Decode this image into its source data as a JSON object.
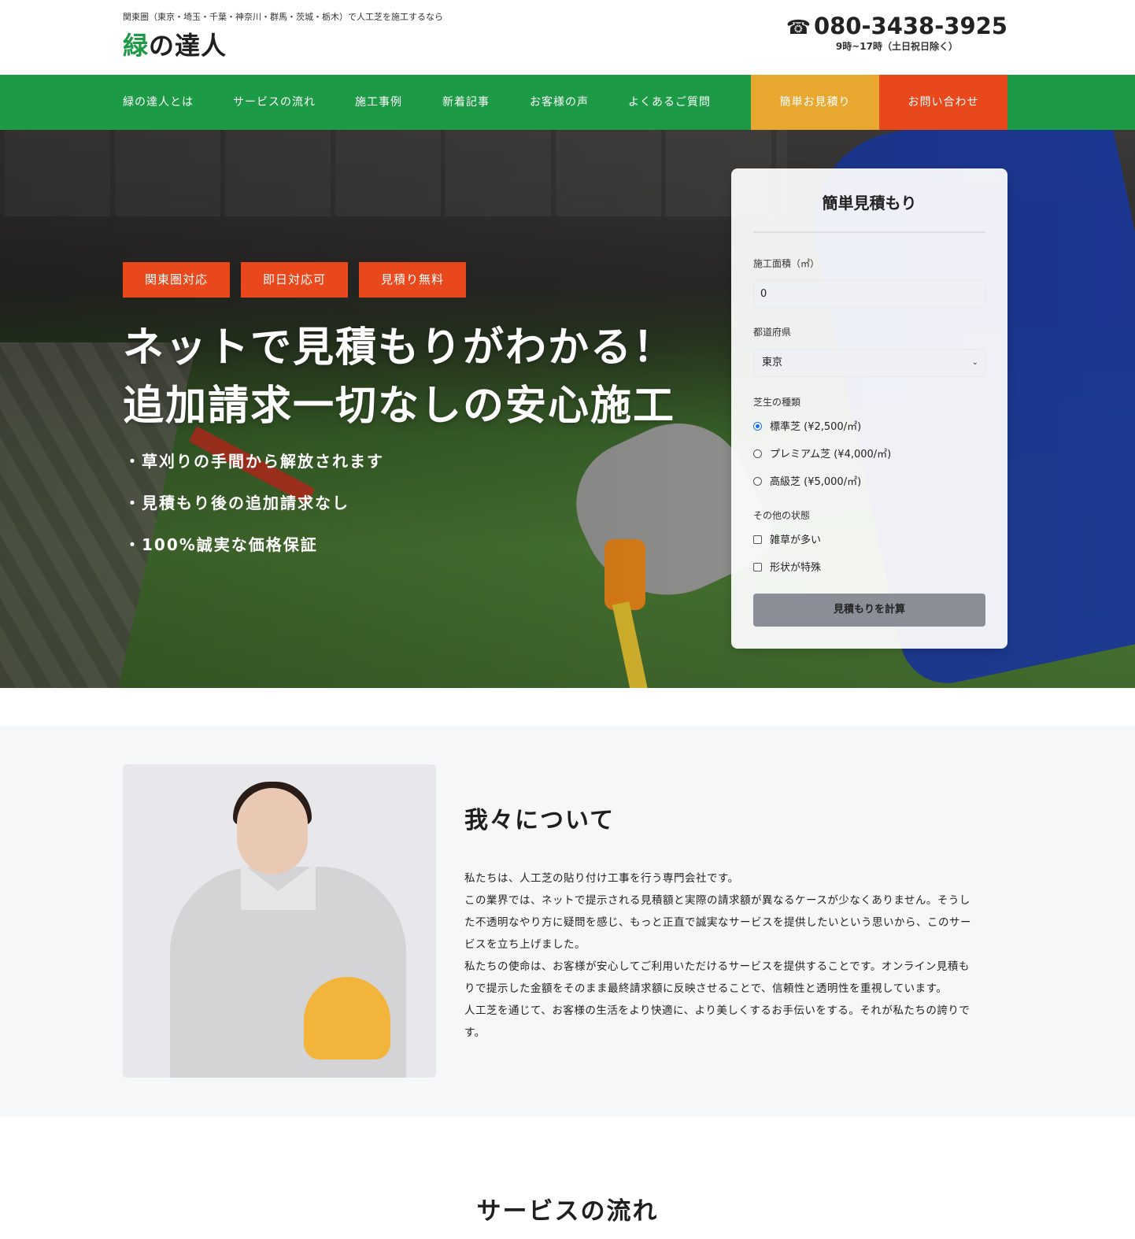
{
  "header": {
    "tagline": "関東圏（東京・埼玉・千葉・神奈川・群馬・茨城・栃木）で人工芝を施工するなら",
    "logo_accent": "緑",
    "logo_rest": "の達人",
    "phone_icon": "☎",
    "phone": "080-3438-3925",
    "hours": "9時~17時（土日祝日除く）"
  },
  "nav": {
    "items": [
      "緑の達人とは",
      "サービスの流れ",
      "施工事例",
      "新着記事",
      "お客様の声",
      "よくあるご質問"
    ],
    "estimate_label": "簡単お見積り",
    "contact_label": "お問い合わせ",
    "colors": {
      "nav_bg": "#1c9a45",
      "estimate_bg": "#e8a830",
      "contact_bg": "#e8481c"
    }
  },
  "hero": {
    "badges": [
      "関東圏対応",
      "即日対応可",
      "見積り無料"
    ],
    "title_line1": "ネットで見積もりがわかる！",
    "title_line2": "追加請求一切なしの安心施工",
    "points": [
      "・草刈りの手間から解放されます",
      "・見積もり後の追加請求なし",
      "・100%誠実な価格保証"
    ]
  },
  "estimate_form": {
    "title": "簡単見積もり",
    "area_label": "施工面積（㎡）",
    "area_value": "0",
    "prefecture_label": "都道府県",
    "prefecture_value": "東京",
    "grass_label": "芝生の種類",
    "grass_options": [
      {
        "label": "標準芝 (¥2,500/㎡)",
        "checked": true
      },
      {
        "label": "プレミアム芝 (¥4,000/㎡)",
        "checked": false
      },
      {
        "label": "高級芝 (¥5,000/㎡)",
        "checked": false
      }
    ],
    "other_label": "その他の状態",
    "other_options": [
      {
        "label": "雑草が多い",
        "checked": false
      },
      {
        "label": "形状が特殊",
        "checked": false
      }
    ],
    "submit_label": "見積もりを計算"
  },
  "about": {
    "title": "我々について",
    "paragraphs": [
      "私たちは、人工芝の貼り付け工事を行う専門会社です。",
      "この業界では、ネットで提示される見積額と実際の請求額が異なるケースが少なくありません。そうした不透明なやり方に疑問を感じ、もっと正直で誠実なサービスを提供したいという思いから、このサービスを立ち上げました。",
      "私たちの使命は、お客様が安心してご利用いただけるサービスを提供することです。オンライン見積もりで提示した金額をそのまま最終請求額に反映させることで、信頼性と透明性を重視しています。",
      "人工芝を通じて、お客様の生活をより快適に、より美しくするお手伝いをする。それが私たちの誇りです。"
    ]
  },
  "next_section": {
    "title": "サービスの流れ"
  }
}
